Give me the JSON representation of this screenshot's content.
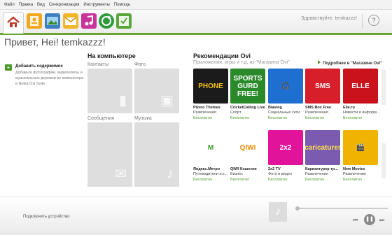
{
  "menu": [
    "Файл",
    "Правка",
    "Вид",
    "Синхронизация",
    "Инструменты",
    "Помощь"
  ],
  "toolbar": {
    "greeting": "Здравствуйте, temkazzz!",
    "help": "?",
    "icons": [
      "home-icon",
      "contacts-icon",
      "photos-icon",
      "messages-icon",
      "music-icon",
      "sync-icon",
      "tasks-icon"
    ]
  },
  "page_title": "Привет, Hei! temkazzz!",
  "add_content": {
    "title": "Добавить содержимое",
    "description": "Добавьте фотографии, видеоклипы и музыкальные дорожки из компьютера в Nokia Ovi Suite."
  },
  "computer": {
    "title": "На компьютере",
    "tiles": [
      {
        "label": "Контакты"
      },
      {
        "label": "Фото"
      },
      {
        "label": "Сообщения"
      },
      {
        "label": "Музыка"
      }
    ]
  },
  "ovi": {
    "title": "Рекомендации Ovi",
    "subtitle": "Приложения, игры и т.д. из \"Магазина Ovi\"",
    "more_link": "Подробнее в \"Магазине Ovi\"",
    "row1": [
      {
        "name": "Pizero Themes",
        "category": "Развлечения",
        "price": "Бесплатно",
        "art": "PHONE",
        "bg": "#1b1b1b",
        "fg": "#f3c21a"
      },
      {
        "name": "CricketCalling Live",
        "category": "Спорт",
        "price": "Бесплатно",
        "art": "SPORTS GURD FREE!",
        "bg": "#2a8a2a",
        "fg": "#ffffff"
      },
      {
        "name": "Blaving",
        "category": "Социальные сети",
        "price": "Бесплатно",
        "art": "🎧",
        "bg": "#1f6fd1",
        "fg": "#ffffff"
      },
      {
        "name": "SMS Box Free",
        "category": "Развлечения",
        "price": "Бесплатно",
        "art": "SMS",
        "bg": "#d61f2a",
        "fg": "#ffffff"
      },
      {
        "name": "Elle.ru",
        "category": "Новости и информ...",
        "price": "Бесплатно",
        "art": "ELLE",
        "bg": "#c9121c",
        "fg": "#ffffff"
      }
    ],
    "row2": [
      {
        "name": "Яндекс.Метро",
        "category": "Путеводители и к...",
        "price": "Бесплатно",
        "art": "M",
        "bg": "#ffffff",
        "fg": "#3a9a2a"
      },
      {
        "name": "QIWI Кошелек",
        "category": "Бизнес",
        "price": "Бесплатно",
        "art": "QIWI",
        "bg": "#ffffff",
        "fg": "#f08a00"
      },
      {
        "name": "2x2 TV",
        "category": "Фото и видео",
        "price": "Бесплатно",
        "art": "2x2",
        "bg": "#e1139a",
        "fg": "#ffffff"
      },
      {
        "name": "Карикатурер тр...",
        "category": "Развлечения",
        "price": "Бесплатно",
        "art": "caricaturer",
        "bg": "#7b5bb0",
        "fg": "#ffe14a"
      },
      {
        "name": "New Movies",
        "category": "Развлечения",
        "price": "Бесплатно",
        "art": "🎬",
        "bg": "#f0b400",
        "fg": "#222222"
      }
    ]
  },
  "bottom": {
    "connect_label": "Подключить устройство",
    "progress": 0.0
  },
  "colors": {
    "accent": "#6aa531",
    "price_green": "#4c9a2a"
  }
}
